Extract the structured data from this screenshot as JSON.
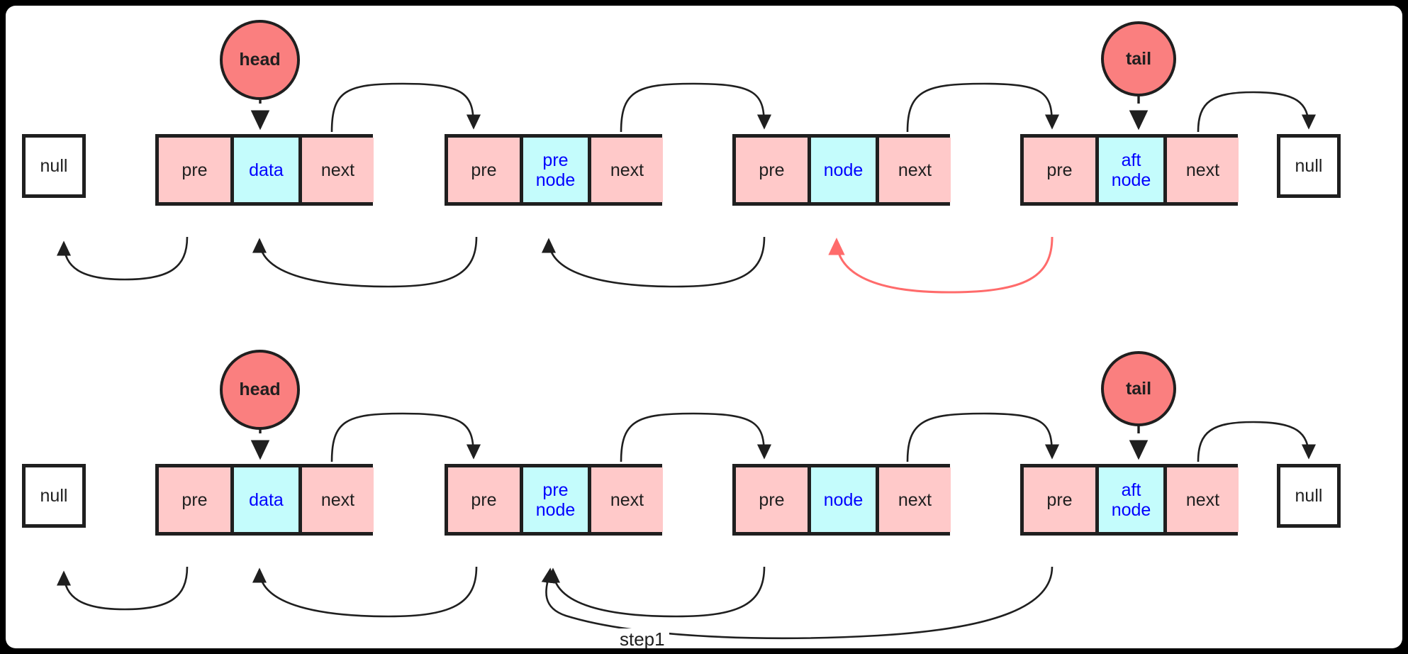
{
  "diagram": {
    "title": "doubly-linked-list-insertion-step1",
    "colors": {
      "node_side": "#ffc9c9",
      "node_data": "#c4fcfc",
      "pointer_circle": "#fa7f7f",
      "stroke": "#1f1f1f",
      "data_text": "#0000ff",
      "highlight_arrow": "#ff6b6b",
      "background": "#ffffff",
      "page": "#000000"
    },
    "rows": [
      {
        "id": "row-before",
        "left_null": "null",
        "right_null": "null",
        "pointers": [
          {
            "id": "head",
            "label": "head",
            "target": "data"
          },
          {
            "id": "tail",
            "label": "tail",
            "target": "aft node"
          }
        ],
        "nodes": [
          {
            "id": "node-data",
            "pre": "pre",
            "data": "data",
            "data_lines": [
              "data"
            ],
            "next": "next"
          },
          {
            "id": "node-pre",
            "pre": "pre",
            "data": "pre node",
            "data_lines": [
              "pre",
              "node"
            ],
            "next": "next"
          },
          {
            "id": "node-new",
            "pre": "pre",
            "data": "node",
            "data_lines": [
              "node"
            ],
            "next": "next"
          },
          {
            "id": "node-aft",
            "pre": "pre",
            "data": "aft node",
            "data_lines": [
              "aft",
              "node"
            ],
            "next": "next"
          }
        ],
        "annotations": []
      },
      {
        "id": "row-after",
        "left_null": "null",
        "right_null": "null",
        "pointers": [
          {
            "id": "head",
            "label": "head",
            "target": "data"
          },
          {
            "id": "tail",
            "label": "tail",
            "target": "aft node"
          }
        ],
        "nodes": [
          {
            "id": "node-data",
            "pre": "pre",
            "data": "data",
            "data_lines": [
              "data"
            ],
            "next": "next"
          },
          {
            "id": "node-pre",
            "pre": "pre",
            "data": "pre node",
            "data_lines": [
              "pre",
              "node"
            ],
            "next": "next"
          },
          {
            "id": "node-new",
            "pre": "pre",
            "data": "node",
            "data_lines": [
              "node"
            ],
            "next": "next"
          },
          {
            "id": "node-aft",
            "pre": "pre",
            "data": "aft node",
            "data_lines": [
              "aft",
              "node"
            ],
            "next": "next"
          }
        ],
        "annotations": [
          {
            "id": "step1",
            "label": "step1",
            "from": "aft node.pre",
            "to": "pre node"
          }
        ]
      }
    ]
  }
}
